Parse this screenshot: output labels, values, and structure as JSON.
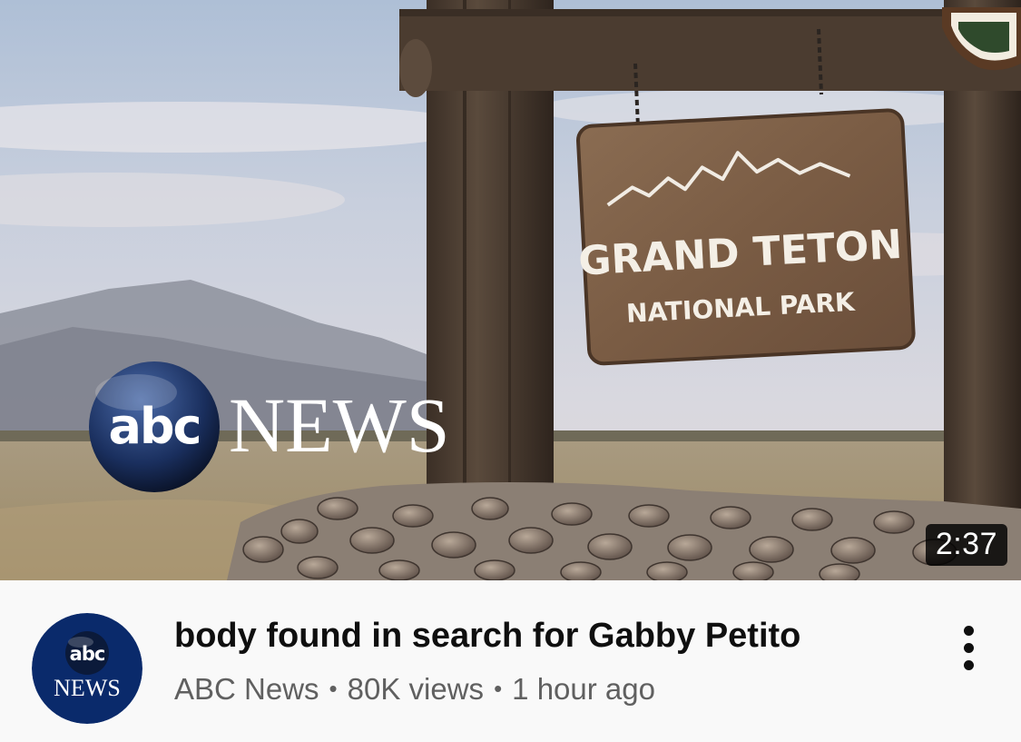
{
  "video": {
    "duration": "2:37",
    "title": "body found in search for Gabby Petito",
    "channel": "ABC News",
    "views": "80K views",
    "age": "1 hour ago",
    "separator": "•"
  },
  "thumbnail": {
    "sign_line1": "GRAND TETON",
    "sign_line2": "NATIONAL PARK",
    "logo_abc": "abc",
    "logo_news": "NEWS"
  },
  "avatar": {
    "logo_abc": "abc",
    "logo_news": "NEWS"
  },
  "icons": {
    "more": "vertical-ellipsis-icon"
  },
  "colors": {
    "title_text": "#0f0f0f",
    "secondary_text": "#606060",
    "avatar_bg": "#0a2a6b",
    "duration_bg": "#000000"
  }
}
